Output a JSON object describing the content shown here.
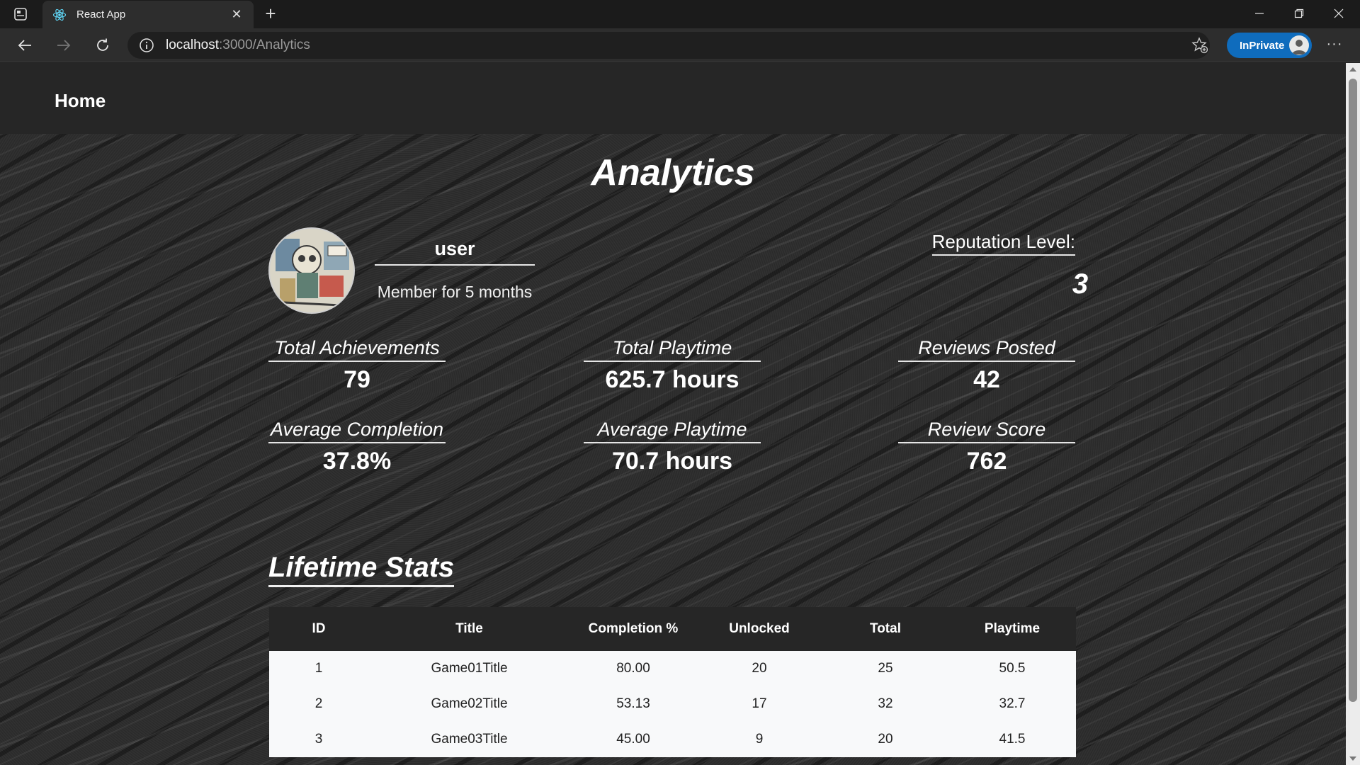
{
  "browser": {
    "tab_title": "React App",
    "url_host": "localhost",
    "url_path": ":3000/Analytics",
    "inprivate_label": "InPrivate",
    "accent": "#0f6cbd"
  },
  "header": {
    "home_label": "Home"
  },
  "page": {
    "title": "Analytics"
  },
  "profile": {
    "username": "user",
    "member_since": "Member for 5 months",
    "reputation_label": "Reputation Level:",
    "reputation_value": "3"
  },
  "stats": [
    {
      "label": "Total Achievements",
      "value": "79"
    },
    {
      "label": "Total Playtime",
      "value": "625.7 hours"
    },
    {
      "label": "Reviews Posted",
      "value": "42"
    },
    {
      "label": "Average Completion",
      "value": "37.8%"
    },
    {
      "label": "Average Playtime",
      "value": "70.7 hours"
    },
    {
      "label": "Review Score",
      "value": "762"
    }
  ],
  "lifetime": {
    "title": "Lifetime Stats",
    "columns": [
      "ID",
      "Title",
      "Completion %",
      "Unlocked",
      "Total",
      "Playtime"
    ],
    "rows": [
      [
        "1",
        "Game01Title",
        "80.00",
        "20",
        "25",
        "50.5"
      ],
      [
        "2",
        "Game02Title",
        "53.13",
        "17",
        "32",
        "32.7"
      ],
      [
        "3",
        "Game03Title",
        "45.00",
        "9",
        "20",
        "41.5"
      ]
    ]
  }
}
